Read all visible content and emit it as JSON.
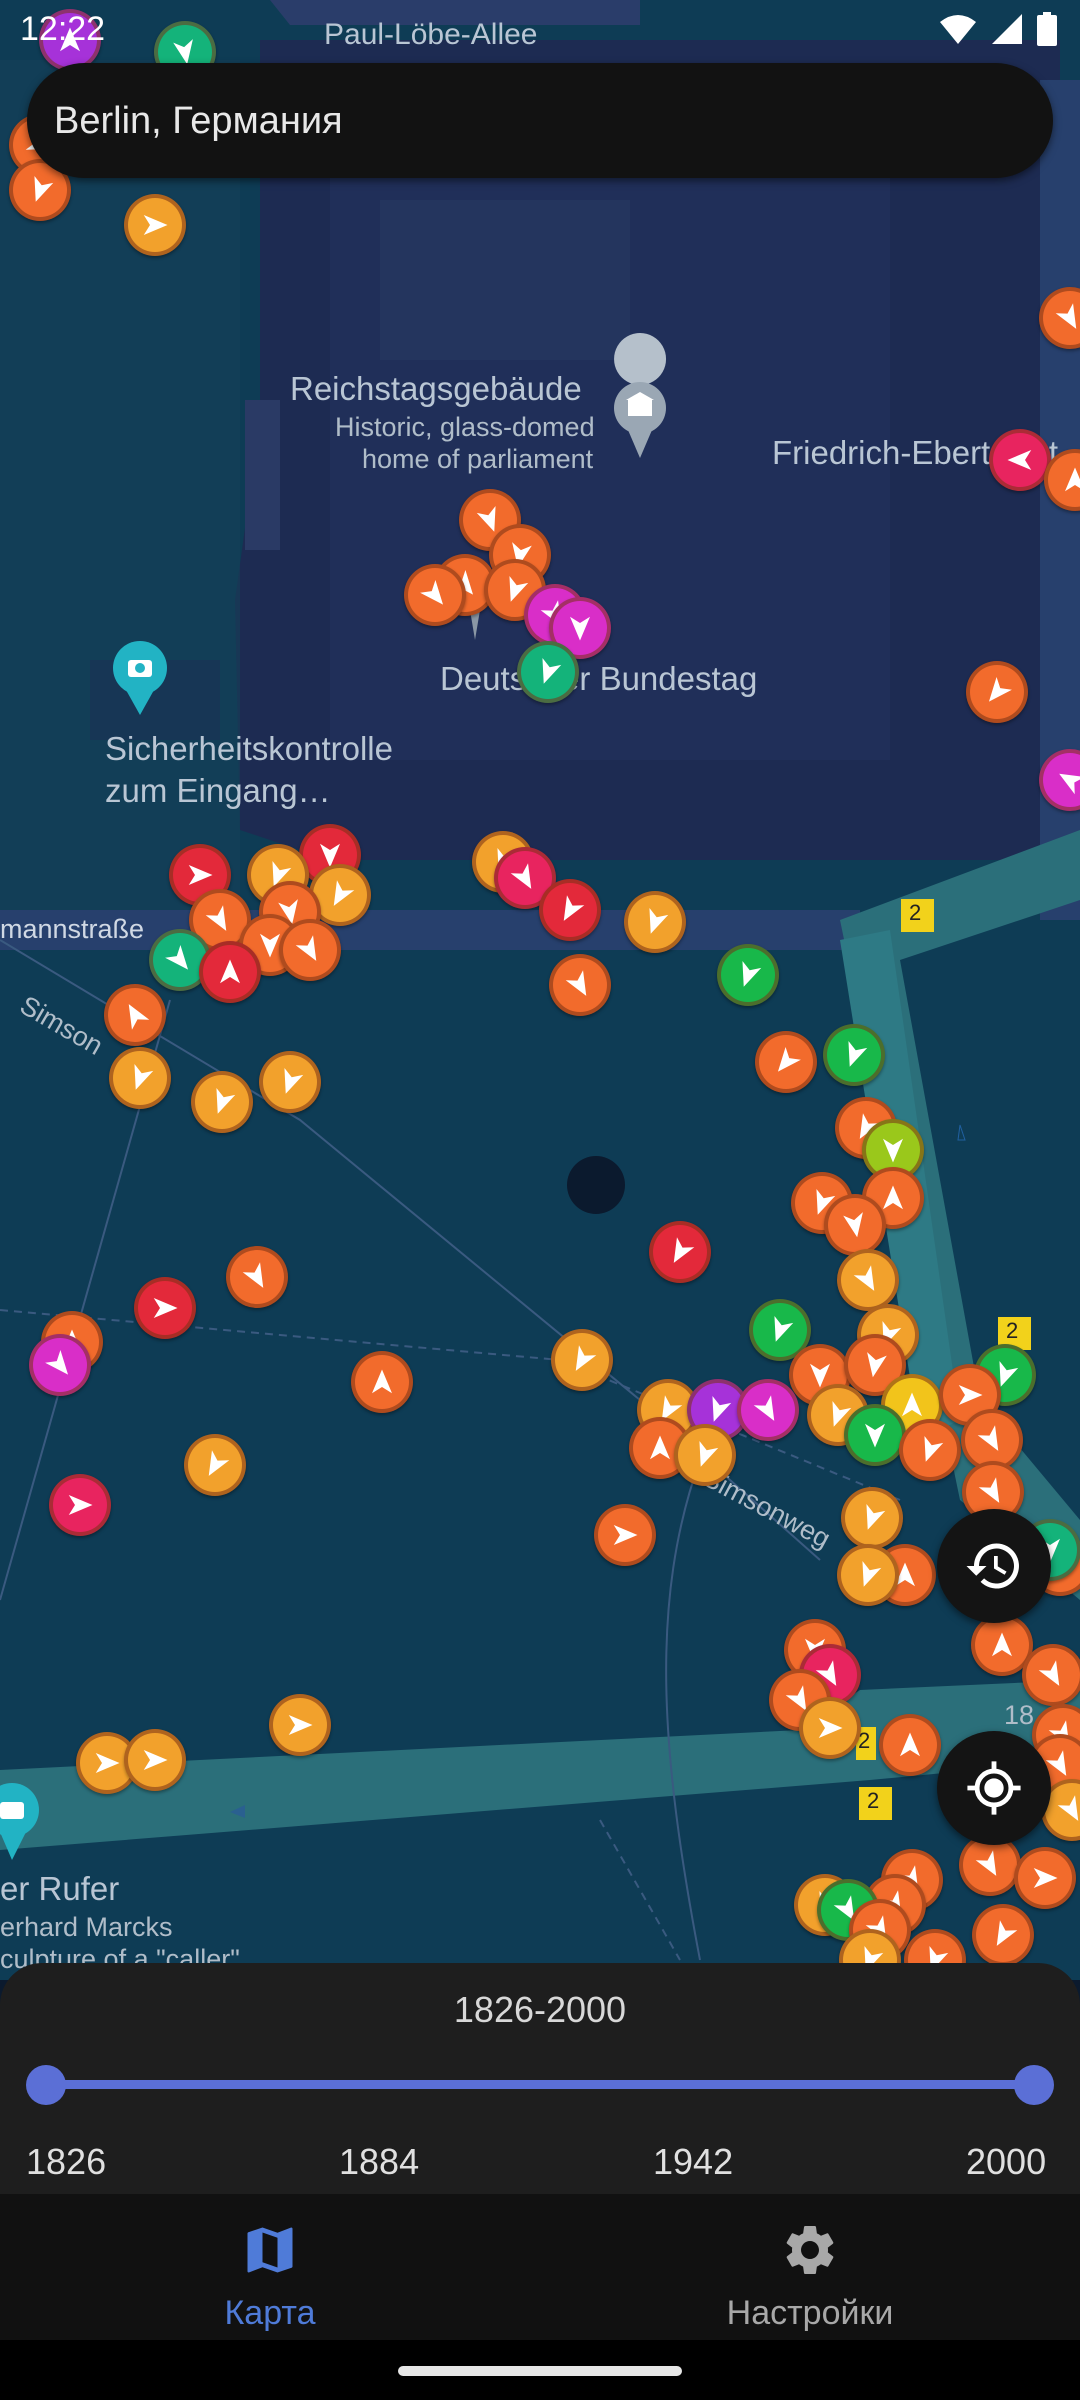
{
  "status_bar": {
    "time": "12:22",
    "icons": [
      "wifi-icon",
      "signal-icon",
      "battery-icon"
    ]
  },
  "search": {
    "value": "Berlin, Германия"
  },
  "map": {
    "labels": {
      "street_top": "Paul-Löbe-Allee",
      "reichstag_title": "Reichstagsgebäude",
      "reichstag_desc_1": "Historic, glass-domed",
      "reichstag_desc_2": "home of parliament",
      "friedrich": "Friedrich-Ebert-Plat",
      "bundestag": "Deutscher Bundestag",
      "security_1": "Sicherheitskontrolle",
      "security_2": "zum Eingang…",
      "street_left": "mannstraße",
      "simson": "Simson",
      "simsonweg": "Simsonweg",
      "rufer": "er Rufer",
      "rufer_sub1": "erhard Marcks",
      "rufer_sub2": "culpture of a \"caller\"",
      "road_sign_1": "2",
      "road_sign_2": "2",
      "road_sign_3": "2",
      "road_sign_4": "2",
      "partial_18": "18"
    },
    "marker_colors": {
      "orange": "#f26b2c",
      "red": "#e3293a",
      "amber": "#f2a12c",
      "green": "#18b84a",
      "teal": "#14b37a",
      "magenta": "#d92ec8",
      "pink": "#e8245f",
      "purple": "#a632d9",
      "lime": "#9ac81b",
      "yellow": "#f2c41b",
      "deeporange": "#f0512b"
    }
  },
  "fabs": {
    "history": "history-icon",
    "location": "my-location-icon"
  },
  "range": {
    "title": "1826-2000",
    "min": 1826,
    "max": 2000,
    "selected_start": 1826,
    "selected_end": 2000,
    "ticks": [
      "1826",
      "1884",
      "1942",
      "2000"
    ]
  },
  "nav": {
    "items": [
      {
        "label": "Карта",
        "icon": "map-icon",
        "active": true,
        "color": "#4f7bd8"
      },
      {
        "label": "Настройки",
        "icon": "gear-icon",
        "active": false,
        "color": "#a8a8a8"
      }
    ]
  }
}
